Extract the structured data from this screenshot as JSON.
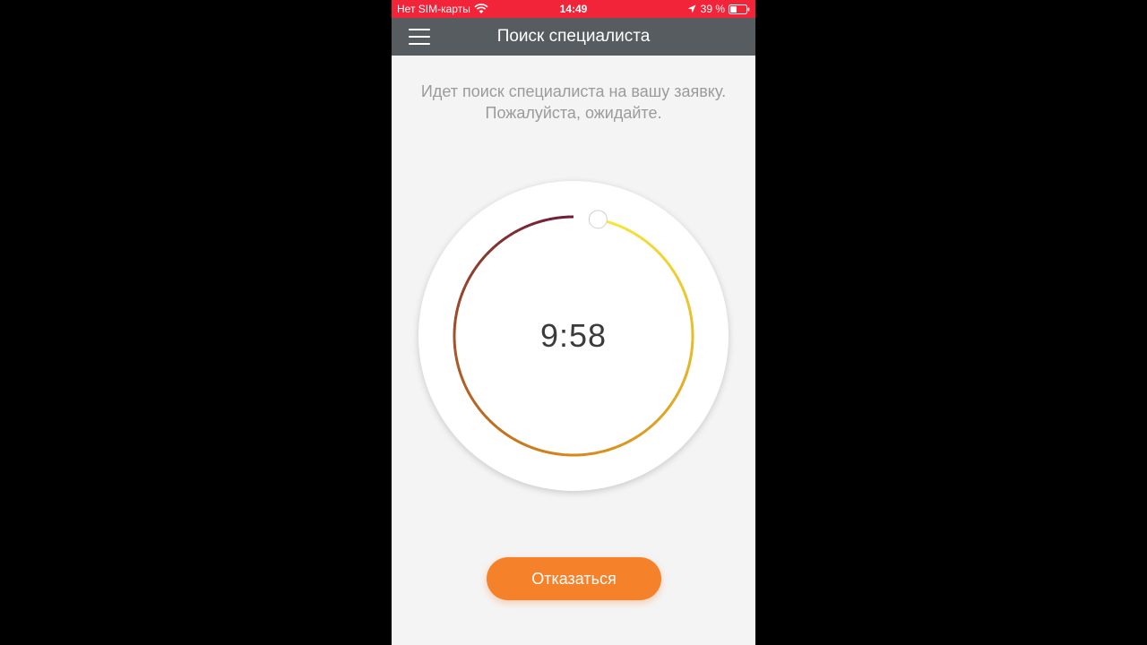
{
  "status_bar": {
    "carrier": "Нет SIM-карты",
    "time": "14:49",
    "battery": "39 %"
  },
  "nav": {
    "title": "Поиск специалиста"
  },
  "main": {
    "message": "Идет поиск специалиста на вашу заявку. Пожалуйста, ожидайте.",
    "timer": "9:58",
    "progress_fraction": 0.967,
    "cancel_label": "Отказаться"
  },
  "colors": {
    "status_bar": "#f2243a",
    "nav_bar": "#575c61",
    "button": "#f5822a",
    "ring_start": "#f6e93a",
    "ring_mid": "#d4841a",
    "ring_end": "#6b1a3a"
  }
}
